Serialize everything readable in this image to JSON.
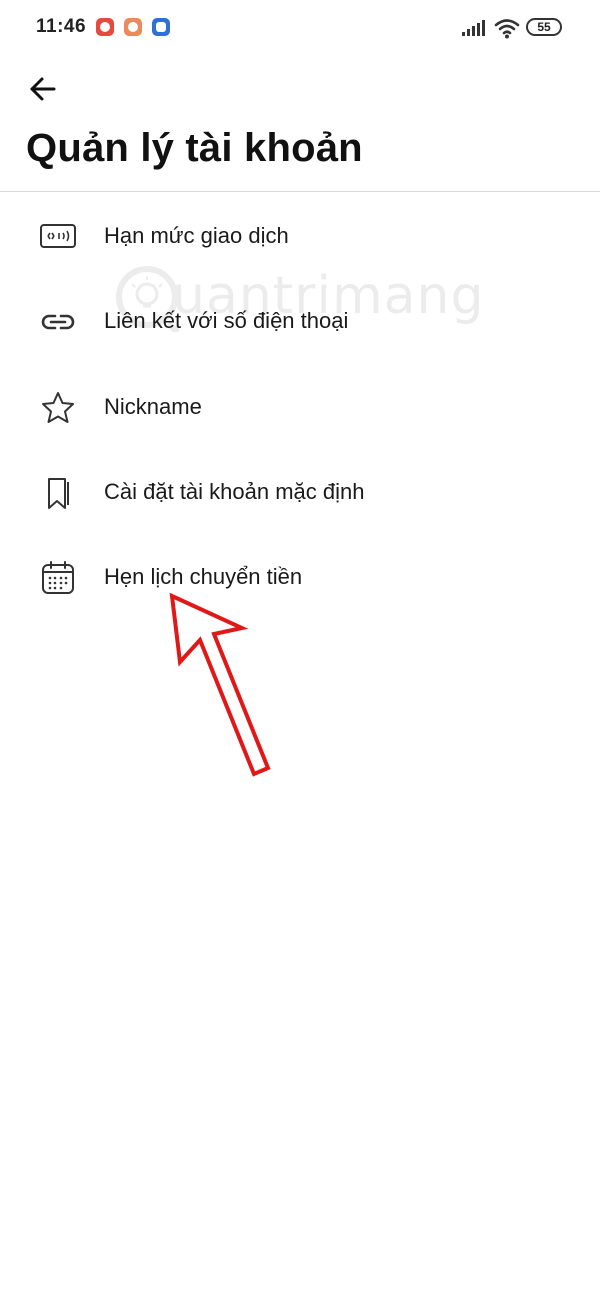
{
  "status_bar": {
    "time": "11:46",
    "battery": "55",
    "icons": [
      "notification-app-icon",
      "notification-app-icon",
      "notification-app-icon",
      "signal-icon",
      "wifi-icon",
      "battery-icon"
    ]
  },
  "header": {
    "back_icon": "arrow-left-icon",
    "title": "Quản lý tài khoản"
  },
  "menu": {
    "items": [
      {
        "label": "Hạn mức giao dịch",
        "icon": "card-limit-icon"
      },
      {
        "label": "Liên kết với số điện thoại",
        "icon": "link-icon"
      },
      {
        "label": "Nickname",
        "icon": "star-icon"
      },
      {
        "label": "Cài đặt tài khoản mặc định",
        "icon": "bookmark-icon"
      },
      {
        "label": "Hẹn lịch chuyển tiền",
        "icon": "calendar-icon"
      }
    ]
  },
  "watermark": {
    "text": "uantrimang"
  },
  "annotation": {
    "color": "#e01818"
  }
}
